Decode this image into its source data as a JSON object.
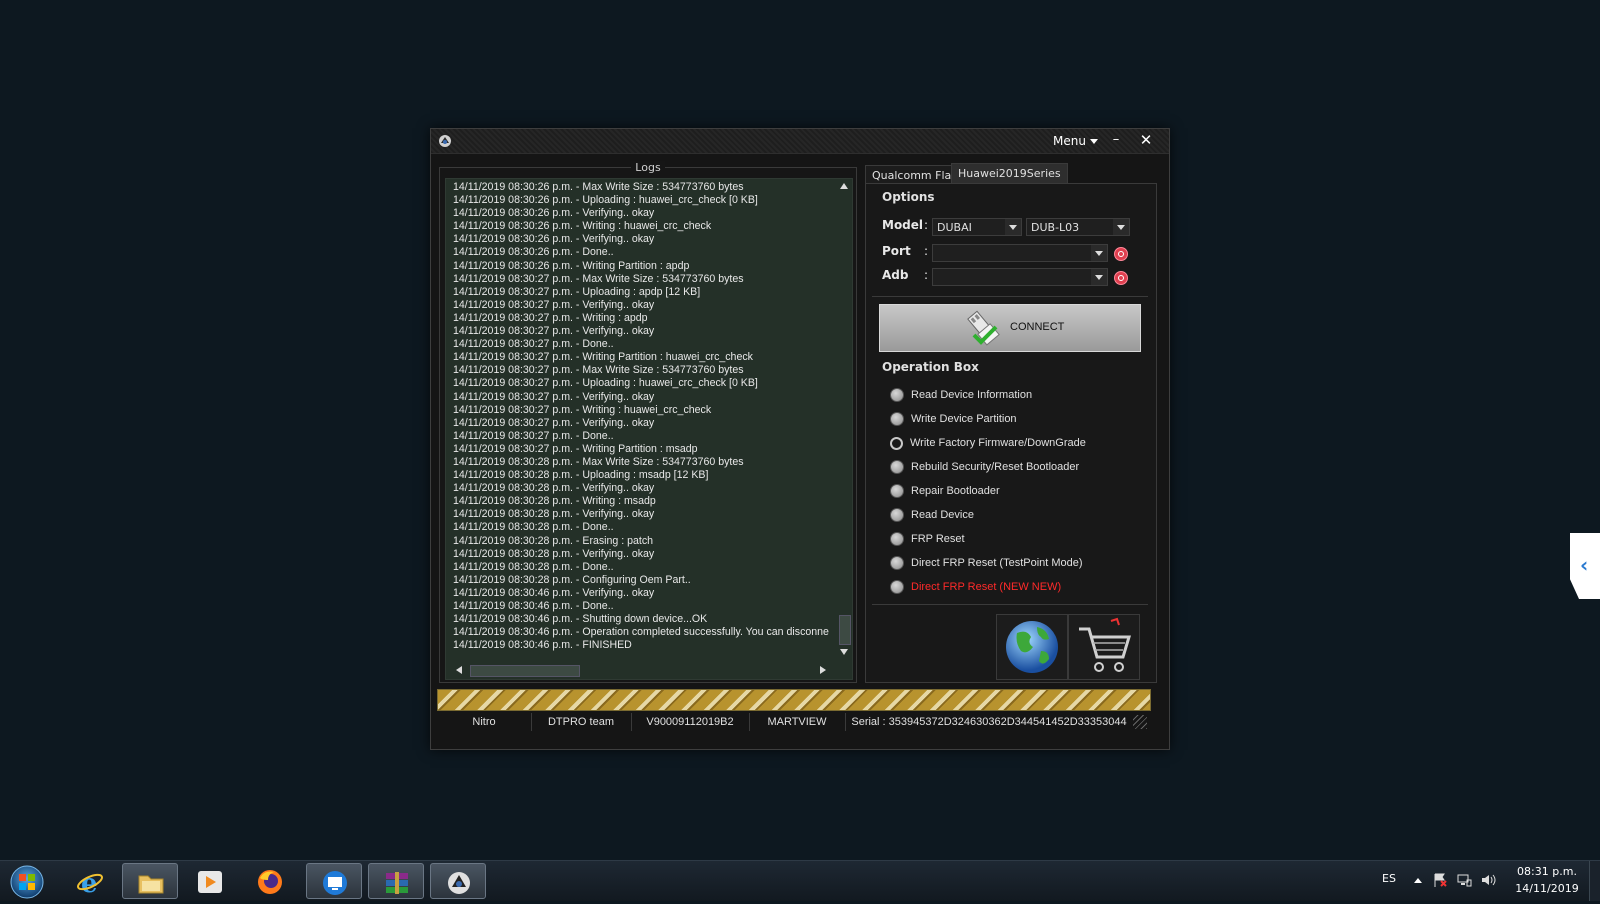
{
  "window": {
    "menu_label": "Menu",
    "minimize_label": "–",
    "close_label": "✕"
  },
  "logs": {
    "title": "Logs",
    "lines": [
      "14/11/2019 08:30:26 p.m. - Max Write Size : 534773760 bytes",
      "14/11/2019 08:30:26 p.m. - Uploading : huawei_crc_check [0 KB]",
      "14/11/2019 08:30:26 p.m. - Verifying.. okay",
      "14/11/2019 08:30:26 p.m. - Writing : huawei_crc_check",
      "14/11/2019 08:30:26 p.m. - Verifying.. okay",
      "14/11/2019 08:30:26 p.m. - Done..",
      "14/11/2019 08:30:26 p.m. - Writing Partition : apdp",
      "14/11/2019 08:30:27 p.m. - Max Write Size : 534773760 bytes",
      "14/11/2019 08:30:27 p.m. - Uploading : apdp [12 KB]",
      "14/11/2019 08:30:27 p.m. - Verifying.. okay",
      "14/11/2019 08:30:27 p.m. - Writing : apdp",
      "14/11/2019 08:30:27 p.m. - Verifying.. okay",
      "14/11/2019 08:30:27 p.m. - Done..",
      "14/11/2019 08:30:27 p.m. - Writing Partition : huawei_crc_check",
      "14/11/2019 08:30:27 p.m. - Max Write Size : 534773760 bytes",
      "14/11/2019 08:30:27 p.m. - Uploading : huawei_crc_check [0 KB]",
      "14/11/2019 08:30:27 p.m. - Verifying.. okay",
      "14/11/2019 08:30:27 p.m. - Writing : huawei_crc_check",
      "14/11/2019 08:30:27 p.m. - Verifying.. okay",
      "14/11/2019 08:30:27 p.m. - Done..",
      "14/11/2019 08:30:27 p.m. - Writing Partition : msadp",
      "14/11/2019 08:30:28 p.m. - Max Write Size : 534773760 bytes",
      "14/11/2019 08:30:28 p.m. - Uploading : msadp [12 KB]",
      "14/11/2019 08:30:28 p.m. - Verifying.. okay",
      "14/11/2019 08:30:28 p.m. - Writing : msadp",
      "14/11/2019 08:30:28 p.m. - Verifying.. okay",
      "14/11/2019 08:30:28 p.m. - Done..",
      "14/11/2019 08:30:28 p.m. - Erasing : patch",
      "14/11/2019 08:30:28 p.m. - Verifying.. okay",
      "14/11/2019 08:30:28 p.m. - Done..",
      "14/11/2019 08:30:28 p.m. - Configuring Oem Part..",
      "14/11/2019 08:30:46 p.m. - Verifying.. okay",
      "14/11/2019 08:30:46 p.m. - Done..",
      "14/11/2019 08:30:46 p.m. - Shutting down device...OK",
      "14/11/2019 08:30:46 p.m. - Operation completed successfully. You can disconne",
      "14/11/2019 08:30:46 p.m. - FINISHED"
    ]
  },
  "tabs": [
    {
      "label": "Qualcomm Flash"
    },
    {
      "label": "Huawei2019Series"
    }
  ],
  "options": {
    "title": "Options",
    "model_label": "Model",
    "model_value": "DUBAI",
    "variant_value": "DUB-L03",
    "port_label": "Port",
    "port_value": "",
    "adb_label": "Adb",
    "adb_value": "",
    "colon": ":"
  },
  "connect_label": "CONNECT",
  "operation_box": {
    "title": "Operation Box",
    "items": [
      {
        "label": "Read Device Information",
        "selected": false
      },
      {
        "label": "Write Device Partition",
        "selected": false
      },
      {
        "label": "Write Factory Firmware/DownGrade",
        "selected": true
      },
      {
        "label": "Rebuild Security/Reset Bootloader",
        "selected": false
      },
      {
        "label": "Repair Bootloader",
        "selected": false
      },
      {
        "label": "Read Device",
        "selected": false
      },
      {
        "label": "FRP Reset",
        "selected": false
      },
      {
        "label": "Direct FRP Reset (TestPoint Mode)",
        "selected": false
      },
      {
        "label": "Direct FRP Reset (NEW NEW)",
        "selected": false,
        "color": "#ff2a2a"
      }
    ]
  },
  "progress": {
    "value": 1.0
  },
  "status_bar": {
    "cells": [
      "Nitro",
      "DTPRO team",
      "V90009112019B2",
      "MARTVIEW",
      "Serial : 353945372D324630362D344541452D33353044"
    ]
  },
  "taskbar": {
    "language": "ES",
    "time": "08:31 p.m.",
    "date": "14/11/2019"
  },
  "colors": {
    "log_background": "#243028",
    "progress_stripe": "#b8932e",
    "accent_red": "#ff2a2a"
  }
}
